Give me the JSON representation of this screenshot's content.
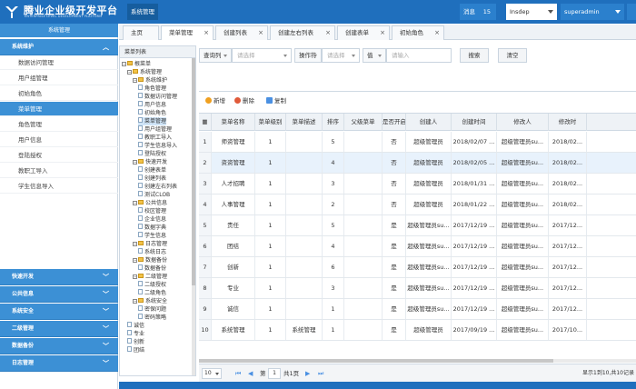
{
  "header": {
    "logo_title": "腾业企业级开发平台",
    "logo_subtitle": "ENTERPRISE LEVEL DEVELOPMENT PLATFORM",
    "system_tab": "系统管理",
    "messages_label": "消息",
    "messages_count": "15",
    "dept_select": "Insdep",
    "user_select": "superadmin"
  },
  "sidebar": {
    "head": "系统管理",
    "section_main": "系统维护",
    "items": [
      "数据访问管理",
      "用户组管理",
      "初始角色",
      "菜单管理",
      "角色管理",
      "用户信息",
      "登陆授权",
      "教职工导入",
      "学生信息导入"
    ],
    "active_index": 3,
    "bottom_sections": [
      "快速开发",
      "公共信息",
      "系统安全",
      "二级管理",
      "数据备份",
      "日志管理"
    ]
  },
  "tabs": [
    {
      "label": "主页",
      "closable": false
    },
    {
      "label": "菜单管理",
      "closable": true
    },
    {
      "label": "创建列表",
      "closable": true
    },
    {
      "label": "创建左右列表",
      "closable": true
    },
    {
      "label": "创建表单",
      "closable": true
    },
    {
      "label": "初始角色",
      "closable": true
    }
  ],
  "tree": {
    "title": "菜单列表",
    "nodes": [
      {
        "label": "根菜单",
        "depth": 0,
        "type": "folder",
        "pm": "−"
      },
      {
        "label": "系统管理",
        "depth": 1,
        "type": "folder",
        "pm": "−"
      },
      {
        "label": "系统维护",
        "depth": 2,
        "type": "folder",
        "pm": "−"
      },
      {
        "label": "角色管理",
        "depth": 3,
        "type": "file"
      },
      {
        "label": "数据访问管理",
        "depth": 3,
        "type": "file"
      },
      {
        "label": "用户信息",
        "depth": 3,
        "type": "file"
      },
      {
        "label": "初始角色",
        "depth": 3,
        "type": "file"
      },
      {
        "label": "菜单管理",
        "depth": 3,
        "type": "file"
      },
      {
        "label": "用户组管理",
        "depth": 3,
        "type": "file"
      },
      {
        "label": "教职工导入",
        "depth": 3,
        "type": "file"
      },
      {
        "label": "学生信息导入",
        "depth": 3,
        "type": "file"
      },
      {
        "label": "登陆授权",
        "depth": 3,
        "type": "file"
      },
      {
        "label": "快速开发",
        "depth": 2,
        "type": "folder",
        "pm": "−"
      },
      {
        "label": "创建表单",
        "depth": 3,
        "type": "file"
      },
      {
        "label": "创建列表",
        "depth": 3,
        "type": "file"
      },
      {
        "label": "创建左右列表",
        "depth": 3,
        "type": "file"
      },
      {
        "label": "测试CLOB",
        "depth": 3,
        "type": "file"
      },
      {
        "label": "公共信息",
        "depth": 2,
        "type": "folder",
        "pm": "−"
      },
      {
        "label": "校区管理",
        "depth": 3,
        "type": "file"
      },
      {
        "label": "企业信息",
        "depth": 3,
        "type": "file"
      },
      {
        "label": "数据字典",
        "depth": 3,
        "type": "file"
      },
      {
        "label": "学生信息",
        "depth": 3,
        "type": "file"
      },
      {
        "label": "日志管理",
        "depth": 2,
        "type": "folder",
        "pm": "−"
      },
      {
        "label": "系统日志",
        "depth": 3,
        "type": "file"
      },
      {
        "label": "数据备份",
        "depth": 2,
        "type": "folder",
        "pm": "−"
      },
      {
        "label": "数据备份",
        "depth": 3,
        "type": "file"
      },
      {
        "label": "二级管理",
        "depth": 2,
        "type": "folder",
        "pm": "−"
      },
      {
        "label": "二级授权",
        "depth": 3,
        "type": "file"
      },
      {
        "label": "二级角色",
        "depth": 3,
        "type": "file"
      },
      {
        "label": "系统安全",
        "depth": 2,
        "type": "folder",
        "pm": "−"
      },
      {
        "label": "密保问题",
        "depth": 3,
        "type": "file"
      },
      {
        "label": "密码策略",
        "depth": 3,
        "type": "file"
      },
      {
        "label": "诚信",
        "depth": 1,
        "type": "file"
      },
      {
        "label": "专业",
        "depth": 1,
        "type": "file"
      },
      {
        "label": "创新",
        "depth": 1,
        "type": "file"
      },
      {
        "label": "团结",
        "depth": 1,
        "type": "file"
      }
    ]
  },
  "search": {
    "query_col_label": "查询列",
    "query_col_placeholder": "请选择",
    "operator_label": "操作符",
    "operator_placeholder": "请选择",
    "value_label": "值",
    "value_placeholder": "请输入",
    "search_button": "搜索",
    "clear_button": "清空"
  },
  "toolbar": {
    "add": "新增",
    "delete": "删除",
    "copy": "复制"
  },
  "grid": {
    "columns": [
      "菜单名称",
      "菜单级别",
      "菜单描述",
      "排序",
      "父级菜单",
      "是否开启",
      "创建人",
      "创建时间",
      "修改人",
      "修改时"
    ],
    "rows": [
      [
        "师资管理",
        "1",
        "",
        "5",
        "",
        "否",
        "超级管理员",
        "2018/02/07 ...",
        "超级管理员su...",
        "2018/02..."
      ],
      [
        "资资管理",
        "1",
        "",
        "4",
        "",
        "否",
        "超级管理员",
        "2018/02/05 ...",
        "超级管理员su...",
        "2018/02..."
      ],
      [
        "人才招聘",
        "1",
        "",
        "3",
        "",
        "否",
        "超级管理员",
        "2018/01/31 ...",
        "超级管理员su...",
        "2018/02..."
      ],
      [
        "人事管理",
        "1",
        "",
        "2",
        "",
        "否",
        "超级管理员",
        "2018/01/22 ...",
        "超级管理员su...",
        "2018/02..."
      ],
      [
        "责任",
        "1",
        "",
        "5",
        "",
        "是",
        "超级管理员su...",
        "2017/12/19 ...",
        "超级管理员su...",
        "2017/12..."
      ],
      [
        "团结",
        "1",
        "",
        "4",
        "",
        "是",
        "超级管理员su...",
        "2017/12/19 ...",
        "超级管理员su...",
        "2017/12..."
      ],
      [
        "创新",
        "1",
        "",
        "6",
        "",
        "是",
        "超级管理员su...",
        "2017/12/19 ...",
        "超级管理员su...",
        "2017/12..."
      ],
      [
        "专业",
        "1",
        "",
        "3",
        "",
        "是",
        "超级管理员su...",
        "2017/12/19 ...",
        "超级管理员su...",
        "2017/12..."
      ],
      [
        "诚信",
        "1",
        "",
        "1",
        "",
        "是",
        "超级管理员su...",
        "2017/12/19 ...",
        "超级管理员su...",
        "2017/12..."
      ],
      [
        "系统管理",
        "1",
        "系统管理",
        "1",
        "",
        "是",
        "超级管理员",
        "2017/09/19 ...",
        "超级管理员su...",
        "2017/10..."
      ]
    ],
    "highlight_row": 1
  },
  "pager": {
    "page_size": "10",
    "page_label_pre": "第",
    "page_value": "1",
    "page_label_post": "共1页",
    "summary": "显示1到10,共10记录"
  },
  "colors": {
    "primary": "#1f6fbd",
    "sidebar_accent": "#3c90d5",
    "add_icon": "#f0a020",
    "delete_icon": "#e05a3a",
    "copy_icon": "#4a90e2"
  }
}
